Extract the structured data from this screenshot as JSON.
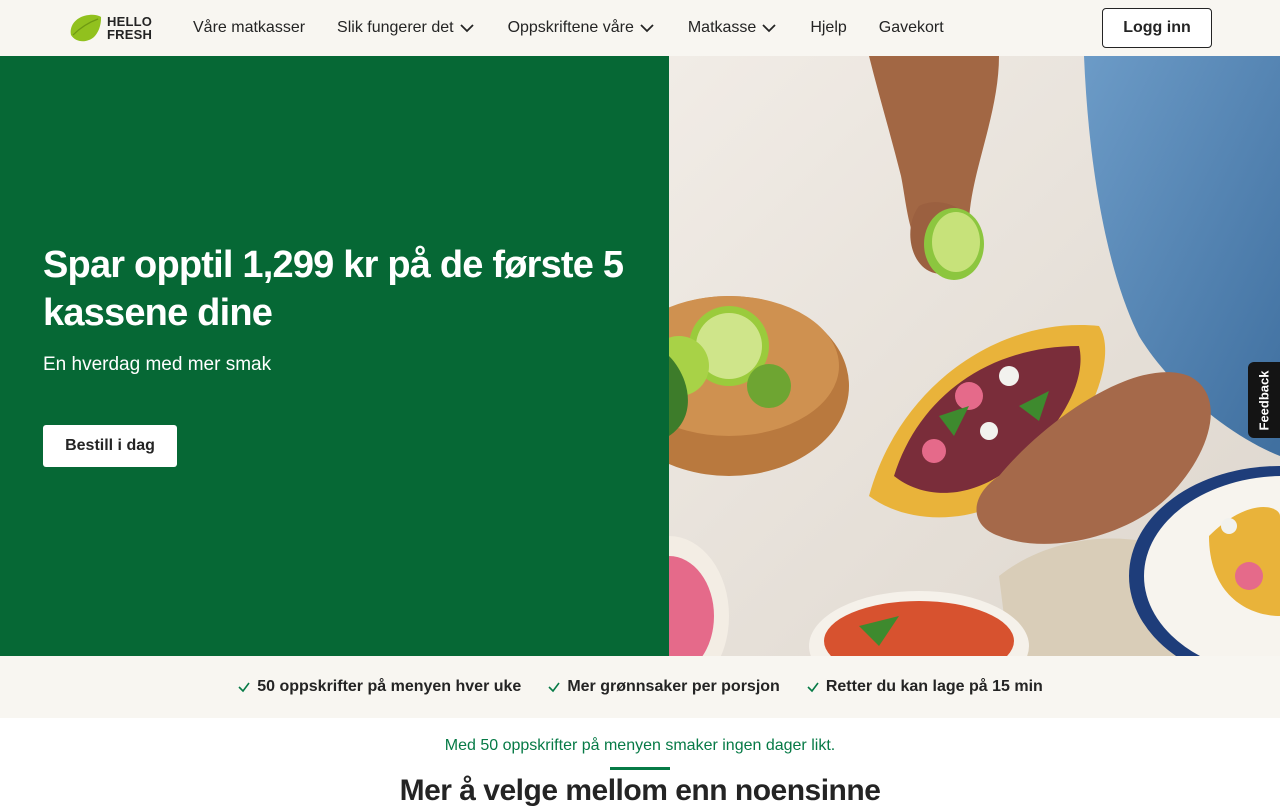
{
  "header": {
    "logo_line1": "HELLO",
    "logo_line2": "FRESH",
    "nav": [
      {
        "label": "Våre matkasser",
        "has_dropdown": false
      },
      {
        "label": "Slik fungerer det",
        "has_dropdown": true
      },
      {
        "label": "Oppskriftene våre",
        "has_dropdown": true
      },
      {
        "label": "Matkasse",
        "has_dropdown": true
      },
      {
        "label": "Hjelp",
        "has_dropdown": false
      },
      {
        "label": "Gavekort",
        "has_dropdown": false
      }
    ],
    "login_label": "Logg inn"
  },
  "hero": {
    "title": "Spar opptil 1,299 kr på de første 5 kassene dine",
    "subtitle": "En hverdag med mer smak",
    "cta_label": "Bestill i dag",
    "image": "tacos-lime-hands-photo"
  },
  "feedback_label": "Feedback",
  "usps": [
    "50 oppskrifter på menyen hver uke",
    "Mer grønnsaker per porsjon",
    "Retter du kan lage på 15 min"
  ],
  "tagline": "Med 50 oppskrifter på menyen smaker ingen dager likt.",
  "section_title": "Mer å velge mellom enn noensinne",
  "colors": {
    "brand_green": "#066835",
    "lime": "#91c11e",
    "header_bg": "#f8f6f1",
    "text": "#242424"
  }
}
